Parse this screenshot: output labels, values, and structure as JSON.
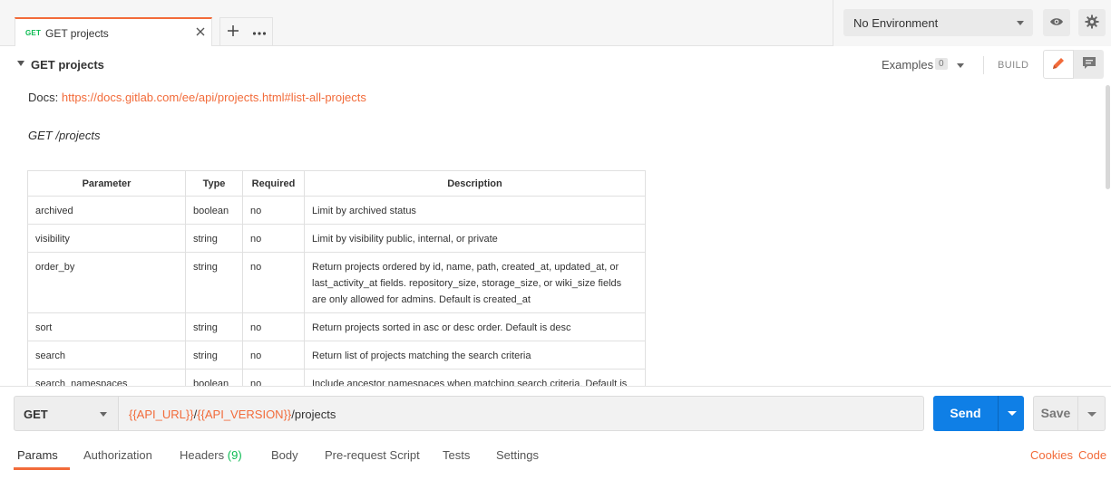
{
  "tab": {
    "method": "GET",
    "title": "GET projects"
  },
  "environment": {
    "selected": "No Environment"
  },
  "doc": {
    "title": "GET projects",
    "examples_label": "Examples",
    "examples_count": "0",
    "build_label": "BUILD",
    "docs_prefix": "Docs:",
    "docs_link": "https://docs.gitlab.com/ee/api/projects.html#list-all-projects",
    "endpoint": "GET /projects"
  },
  "table": {
    "headers": [
      "Parameter",
      "Type",
      "Required",
      "Description"
    ],
    "rows": [
      [
        "archived",
        "boolean",
        "no",
        "Limit by archived status"
      ],
      [
        "visibility",
        "string",
        "no",
        "Limit by visibility public, internal, or private"
      ],
      [
        "order_by",
        "string",
        "no",
        "Return projects ordered by id, name, path, created_at, updated_at, or last_activity_at fields. repository_size, storage_size, or wiki_size fields are only allowed for admins. Default is created_at"
      ],
      [
        "sort",
        "string",
        "no",
        "Return projects sorted in asc or desc order. Default is desc"
      ],
      [
        "search",
        "string",
        "no",
        "Return list of projects matching the search criteria"
      ],
      [
        "search_namespaces",
        "boolean",
        "no",
        "Include ancestor namespaces when matching search criteria. Default is false"
      ]
    ]
  },
  "request": {
    "method": "GET",
    "url_var1": "{{API_URL}}",
    "url_sep": "/",
    "url_var2": "{{API_VERSION}}",
    "url_path": "/projects",
    "send_label": "Send",
    "save_label": "Save"
  },
  "req_tabs": {
    "params": "Params",
    "authorization": "Authorization",
    "headers": "Headers",
    "headers_count": "(9)",
    "body": "Body",
    "prerequest": "Pre-request Script",
    "tests": "Tests",
    "settings": "Settings",
    "cookies": "Cookies",
    "code": "Code"
  },
  "colors": {
    "accent": "#f26b3a",
    "send_blue": "#0f7fe6",
    "get_green": "#0cbb52"
  }
}
